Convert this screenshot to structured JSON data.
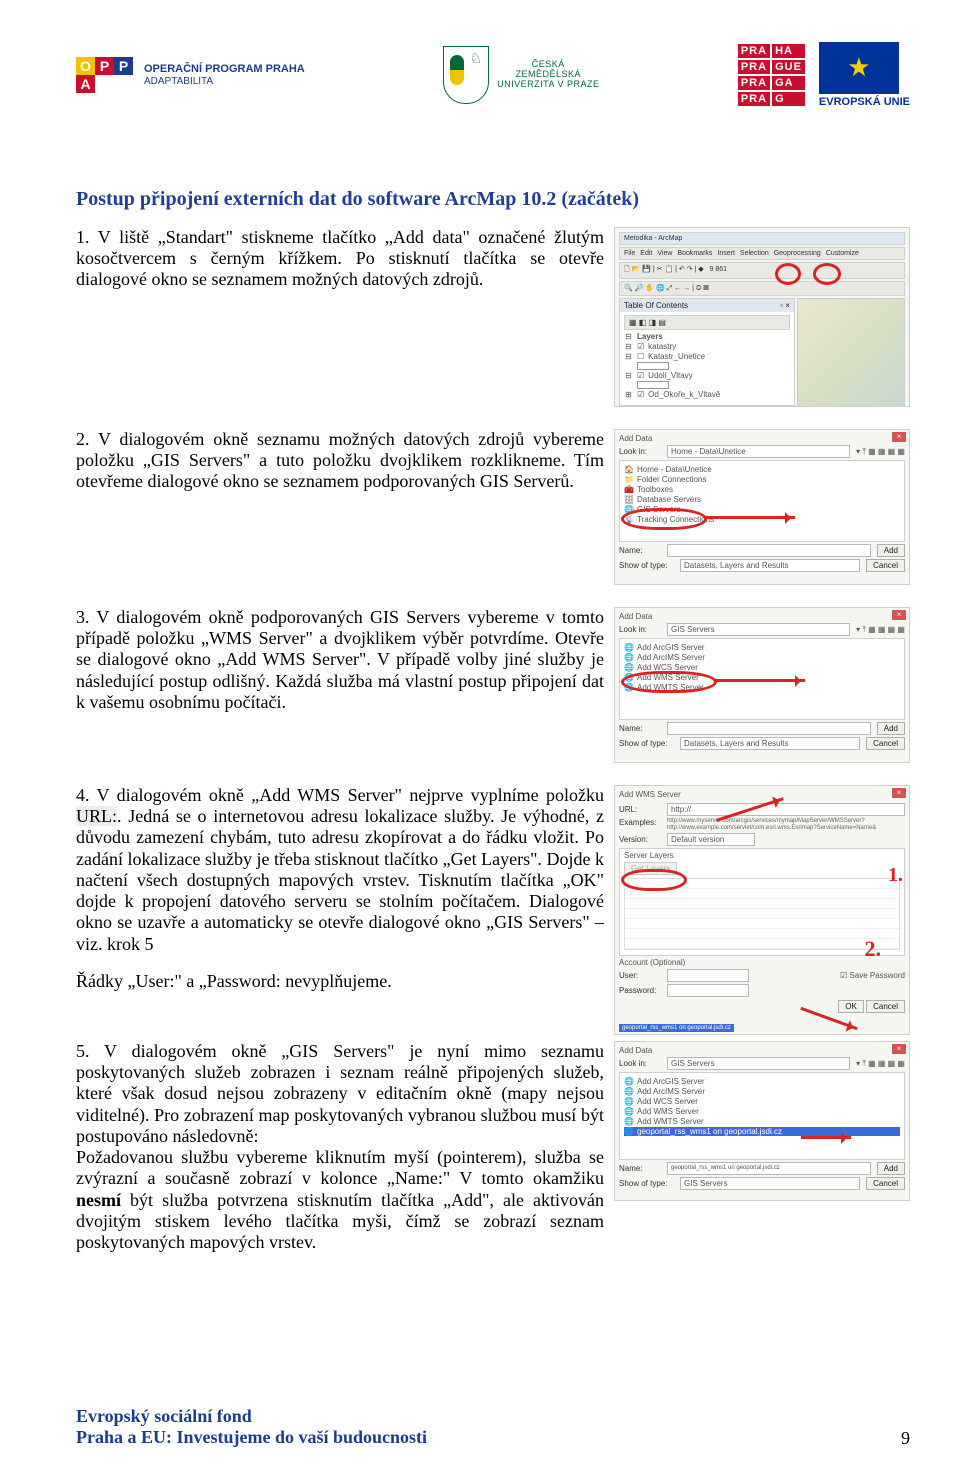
{
  "header": {
    "opp_letters": [
      "O",
      "P",
      "P",
      "A"
    ],
    "opp_title": "OPERAČNÍ PROGRAM PRAHA",
    "opp_sub": "ADAPTABILITA",
    "czu_lines": [
      "ČESKÁ",
      "ZEMĚDĚLSKÁ",
      "UNIVERZITA V PRAZE"
    ],
    "prah_cells": [
      "PRA",
      "HA",
      "PRA",
      "GUE",
      "PRA",
      "GA",
      "PRA",
      "G"
    ],
    "eu_label": "EVROPSKÁ UNIE"
  },
  "title": "Postup připojení externích dat do software ArcMap 10.2 (začátek)",
  "step1": "1. V liště „Standart\" stiskneme tlačítko „Add data\" označené žlutým kosočtvercem s černým křížkem. Po stisknutí tlačítka se otevře dialogové okno se seznamem možných datových zdrojů.",
  "step2": "2. V dialogovém okně seznamu možných datových zdrojů vybereme položku „GIS Servers\" a tuto položku dvojklikem rozklikneme. Tím otevřeme dialogové okno se seznamem podporovaných GIS Serverů.",
  "step3": "3. V dialogovém okně podporovaných GIS Servers vybereme v tomto případě položku „WMS Server\" a dvojklikem výběr potvrdíme. Otevře se dialogové okno „Add WMS Server\". V případě volby jiné služby je následující postup odlišný. Každá služba má vlastní postup připojení dat k vašemu osobnímu počítači.",
  "step4a": "4.  V dialogovém okně „Add WMS Server\" nejprve vyplníme položku ",
  "step4_url": "URL:",
  "step4b": ". Jedná se o internetovou adresu lokalizace služby. Je výhodné, z důvodu zamezení chybám, tuto adresu zkopírovat a do řádku vložit. Po zadání lokalizace služby je třeba stisknout tlačítko „Get Layers\". Dojde k načtení všech dostupných mapových vrstev. Tisknutím tlačítka „OK\" dojde k propojení datového serveru se stolním počítačem. Dialogové okno se uzavře a automaticky se otevře dialogové okno „GIS Servers\" – viz. krok 5",
  "step4c": "Řádky „User:\" a „Password: nevyplňujeme.",
  "step5": "5. V dialogovém okně „GIS Servers\" je nyní mimo seznamu poskytovaných služeb zobrazen i seznam reálně připojených služeb, které však dosud nejsou zobrazeny v editačním okně (mapy nejsou viditelné). Pro zobrazení map poskytovaných vybranou službou musí být postupováno následovně:",
  "step5b": "Požadovanou službu vybereme kliknutím myší (pointerem), služba se zvýrazní a současně zobrazí v kolonce „Name:\" V tomto okamžiku ",
  "step5_strong": "nesmí",
  "step5c": " být služba potvrzena stisknutím tlačítka „Add\", ale aktivován dvojitým stiskem levého tlačítka myši, čímž se zobrazí seznam poskytovaných mapových vrstev.",
  "footer": {
    "line1": "Evropský sociální fond",
    "line2": "Praha a EU: Investujeme do vaší budoucnosti",
    "page": "9"
  },
  "shot1": {
    "app_title": "Metodika - ArcMap",
    "menu": [
      "File",
      "Edit",
      "View",
      "Bookmarks",
      "Insert",
      "Selection",
      "Geoprocessing",
      "Customize"
    ],
    "toc_title": "Table Of Contents",
    "layers": "Layers",
    "items": [
      "katastry",
      "Katastr_Unetice",
      "",
      "Udoli_Vltavy",
      "",
      "Od_Okoře_k_Vltavě"
    ],
    "scale": "9 861"
  },
  "shot2": {
    "title": "Add Data",
    "look_in": "Look in:",
    "look_value": "Home - Data\\Unetice",
    "items": [
      "Home - Data\\Unetice",
      "Folder Connections",
      "Toolboxes",
      "Database Servers",
      "GIS Servers",
      "Tracking Connections"
    ],
    "name": "Name:",
    "show": "Show of type:",
    "show_value": "Datasets, Layers and Results",
    "add": "Add",
    "cancel": "Cancel"
  },
  "shot3": {
    "title": "Add Data",
    "look_in": "Look in:",
    "look_value": "GIS Servers",
    "items": [
      "Add ArcGIS Server",
      "Add ArcIMS Server",
      "Add WCS Server",
      "Add WMS Server",
      "Add WMTS Server"
    ],
    "name": "Name:",
    "show": "Show of type:",
    "show_value": "Datasets, Layers and Results",
    "add": "Add",
    "cancel": "Cancel"
  },
  "shot4": {
    "title": "Add WMS Server",
    "url": "URL:",
    "url_value": "http://",
    "examples_label": "Examples:",
    "examples": [
      "http://www.myserver.com/arcgis/services/mymap/MapServer/WMSServer?",
      "http://www.example.com/servlet/com.esri.wms.Esrimap?ServiceName=Name&"
    ],
    "server_layers": "Server Layers",
    "version": "Version:",
    "version_value": "Default version",
    "get_layers": "Get Layers",
    "acct": "Account (Optional)",
    "user": "User:",
    "pass": "Password:",
    "save_pass": "Save Password",
    "ok": "OK",
    "cancel": "Cancel",
    "anno1": "1.",
    "anno2": "2.",
    "bottom_url": "geoportal_rss_wms1 on geoportal.jsdi.cz"
  },
  "shot5": {
    "title": "Add Data",
    "look_in": "Look in:",
    "look_value": "GIS Servers",
    "items": [
      "Add ArcGIS Server",
      "Add ArcIMS Server",
      "Add WCS Server",
      "Add WMS Server",
      "Add WMTS Server",
      "geoportal_rss_wms1 on geoportal.jsdi.cz"
    ],
    "name": "Name:",
    "name_value": "geoportal_rss_wms1 on geoportal.jsdi.cz",
    "show": "Show of type:",
    "show_value": "GIS Servers",
    "add": "Add",
    "cancel": "Cancel"
  }
}
